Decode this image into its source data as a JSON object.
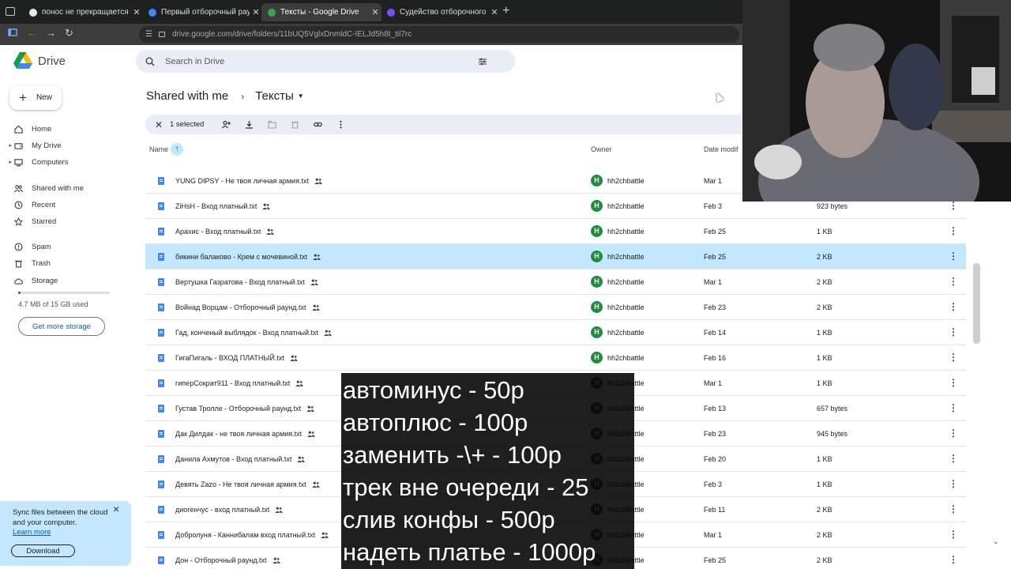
{
  "browser": {
    "tabs": [
      {
        "title": "понос не прекращается недел",
        "favicon_color": "#e8eaed",
        "active": false
      },
      {
        "title": "Первый отборочный раунд -",
        "favicon_color": "#4285f4",
        "active": false
      },
      {
        "title": "Тексты - Google Drive",
        "favicon_color": "#34a853",
        "active": true
      },
      {
        "title": "Судейство отборочного раунд",
        "favicon_color": "#7c4dff",
        "active": false
      }
    ],
    "new_tab": "+",
    "url": "drive.google.com/drive/folders/11bUQ5VglxDnmldC-IELJd5h8t_til7rc"
  },
  "drive": {
    "logo": "Drive",
    "search_placeholder": "Search in Drive",
    "new_label": "New",
    "nav": [
      {
        "label": "Home",
        "icon": "home-icon",
        "caret": false
      },
      {
        "label": "My Drive",
        "icon": "drive-icon",
        "caret": true
      },
      {
        "label": "Computers",
        "icon": "computer-icon",
        "caret": true
      },
      {
        "label": "Shared with me",
        "icon": "people-icon",
        "caret": false
      },
      {
        "label": "Recent",
        "icon": "clock-icon",
        "caret": false
      },
      {
        "label": "Starred",
        "icon": "star-icon",
        "caret": false
      },
      {
        "label": "Spam",
        "icon": "spam-icon",
        "caret": false
      },
      {
        "label": "Trash",
        "icon": "trash-icon",
        "caret": false
      },
      {
        "label": "Storage",
        "icon": "cloud-icon",
        "caret": false
      }
    ],
    "storage_used_fraction": 0.03,
    "storage_text": "4.7 MB of 15 GB used",
    "get_more": "Get more storage",
    "sync": {
      "message": "Sync files between the cloud and your computer.",
      "learn_more": "Learn more",
      "download": "Download"
    },
    "breadcrumb": {
      "root": "Shared with me",
      "current": "Тексты"
    },
    "selection": {
      "count_label": "1 selected"
    },
    "columns": {
      "name": "Name",
      "owner": "Owner",
      "date": "Date modif"
    },
    "files": [
      {
        "name": "YUNG DIPSY - Не твоя личная армия.txt",
        "owner": "hh2chbattle",
        "date": "Mar 1",
        "size": "",
        "selected": false
      },
      {
        "name": "ZiHsH - Вход платный.txt",
        "owner": "hh2chbattle",
        "date": "Feb 3",
        "size": "923 bytes",
        "selected": false
      },
      {
        "name": "Арахис - Вход платный.txt",
        "owner": "hh2chbattle",
        "date": "Feb 25",
        "size": "1 KB",
        "selected": false
      },
      {
        "name": "бикини балаково - Крем с мочевиной.txt",
        "owner": "hh2chbattle",
        "date": "Feb 25",
        "size": "2 KB",
        "selected": true
      },
      {
        "name": "Вертушка Газратова - Вход платный.txt",
        "owner": "hh2chbattle",
        "date": "Mar 1",
        "size": "2 KB",
        "selected": false
      },
      {
        "name": "Войнад Ворцам - Отборочный раунд.txt",
        "owner": "hh2chbattle",
        "date": "Feb 23",
        "size": "2 KB",
        "selected": false
      },
      {
        "name": "Гад, конченый выблядок - Вход платный.txt",
        "owner": "hh2chbattle",
        "date": "Feb 14",
        "size": "1 KB",
        "selected": false
      },
      {
        "name": "ГигаПигаль - ВХОД ПЛАТНЫЙ.txt",
        "owner": "hh2chbattle",
        "date": "Feb 16",
        "size": "1 KB",
        "selected": false
      },
      {
        "name": "гиперСократ911 - Вход платный.txt",
        "owner": "hh2chbattle",
        "date": "Mar 1",
        "size": "1 KB",
        "selected": false
      },
      {
        "name": "Густав Тролле - Отборочный раунд.txt",
        "owner": "hh2chbattle",
        "date": "Feb 13",
        "size": "657 bytes",
        "selected": false
      },
      {
        "name": "Дак Дилдак - не твоя личная армия.txt",
        "owner": "hh2chbattle",
        "date": "Feb 23",
        "size": "945 bytes",
        "selected": false
      },
      {
        "name": "Данила Ахмутов - Вход платный.txt",
        "owner": "hh2chbattle",
        "date": "Feb 20",
        "size": "1 KB",
        "selected": false
      },
      {
        "name": "Девять Zazo - Не твоя личная армия.txt",
        "owner": "hh2chbattle",
        "date": "Feb 3",
        "size": "1 KB",
        "selected": false
      },
      {
        "name": "диогенчус - вход платный.txt",
        "owner": "hh2chbattle",
        "date": "Feb 11",
        "size": "2 KB",
        "selected": false
      },
      {
        "name": "Добролуня - Каннибалам вход платный.txt",
        "owner": "hh2chbattle",
        "date": "Mar 1",
        "size": "2 KB",
        "selected": false
      },
      {
        "name": "Дон - Отборочный раунд.txt",
        "owner": "hh2chbattle",
        "date": "Feb 25",
        "size": "2 KB",
        "selected": false
      }
    ]
  },
  "overlay": {
    "lines": [
      "автоминус - 50р",
      "автоплюс - 100р",
      "заменить -\\+ - 100р",
      "трек вне очереди - 25",
      "слив конфы - 500р",
      "надеть платье - 1000р"
    ]
  }
}
